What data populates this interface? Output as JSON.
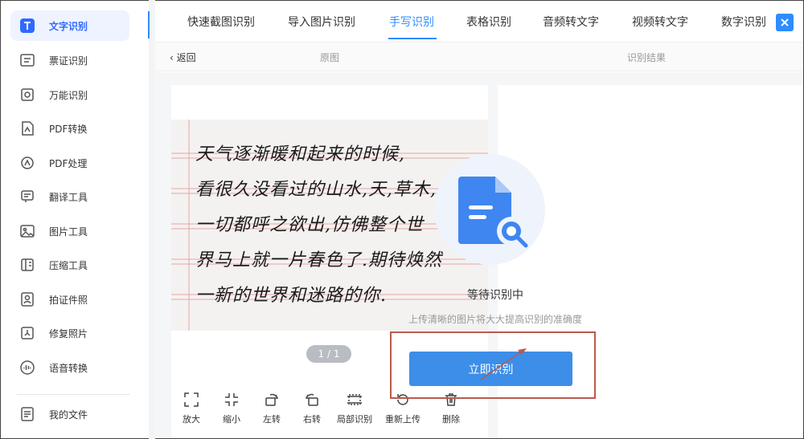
{
  "sidebar": {
    "items": [
      {
        "label": "文字识别",
        "icon": "text-recognition-icon",
        "active": true
      },
      {
        "label": "票证识别",
        "icon": "ticket-icon"
      },
      {
        "label": "万能识别",
        "icon": "universal-scan-icon"
      },
      {
        "label": "PDF转换",
        "icon": "pdf-convert-icon"
      },
      {
        "label": "PDF处理",
        "icon": "pdf-process-icon"
      },
      {
        "label": "翻译工具",
        "icon": "translate-icon"
      },
      {
        "label": "图片工具",
        "icon": "image-tool-icon"
      },
      {
        "label": "压缩工具",
        "icon": "compress-icon"
      },
      {
        "label": "拍证件照",
        "icon": "id-photo-icon"
      },
      {
        "label": "修复照片",
        "icon": "repair-photo-icon"
      },
      {
        "label": "语音转换",
        "icon": "voice-icon"
      }
    ],
    "my_files": "我的文件"
  },
  "tabs": [
    "快速截图识别",
    "导入图片识别",
    "手写识别",
    "表格识别",
    "音频转文字",
    "视频转文字",
    "数字识别"
  ],
  "active_tab": "手写识别",
  "subbar": {
    "back": "返回",
    "original": "原图",
    "result": "识别结果"
  },
  "handwriting": [
    "天气逐渐暖和起来的时候,",
    "看很久没看过的山水,天,草木,",
    "一切都呼之欲出,仿佛整个世",
    "界马上就一片春色了.期待焕然",
    "一新的世界和迷路的你."
  ],
  "pager": "1 / 1",
  "tools": [
    {
      "label": "放大",
      "icon": "zoom-in-icon"
    },
    {
      "label": "缩小",
      "icon": "zoom-out-icon"
    },
    {
      "label": "左转",
      "icon": "rotate-left-icon"
    },
    {
      "label": "右转",
      "icon": "rotate-right-icon"
    },
    {
      "label": "局部识别",
      "icon": "crop-icon"
    },
    {
      "label": "重新上传",
      "icon": "reupload-icon"
    },
    {
      "label": "删除",
      "icon": "trash-icon"
    }
  ],
  "result": {
    "status": "等待识别中",
    "hint": "上传清晰的图片将大大提高识别的准确度",
    "button": "立即识别"
  },
  "colors": {
    "accent": "#2f8cff",
    "button": "#3d8ee8",
    "annotation": "#b85a4e"
  }
}
